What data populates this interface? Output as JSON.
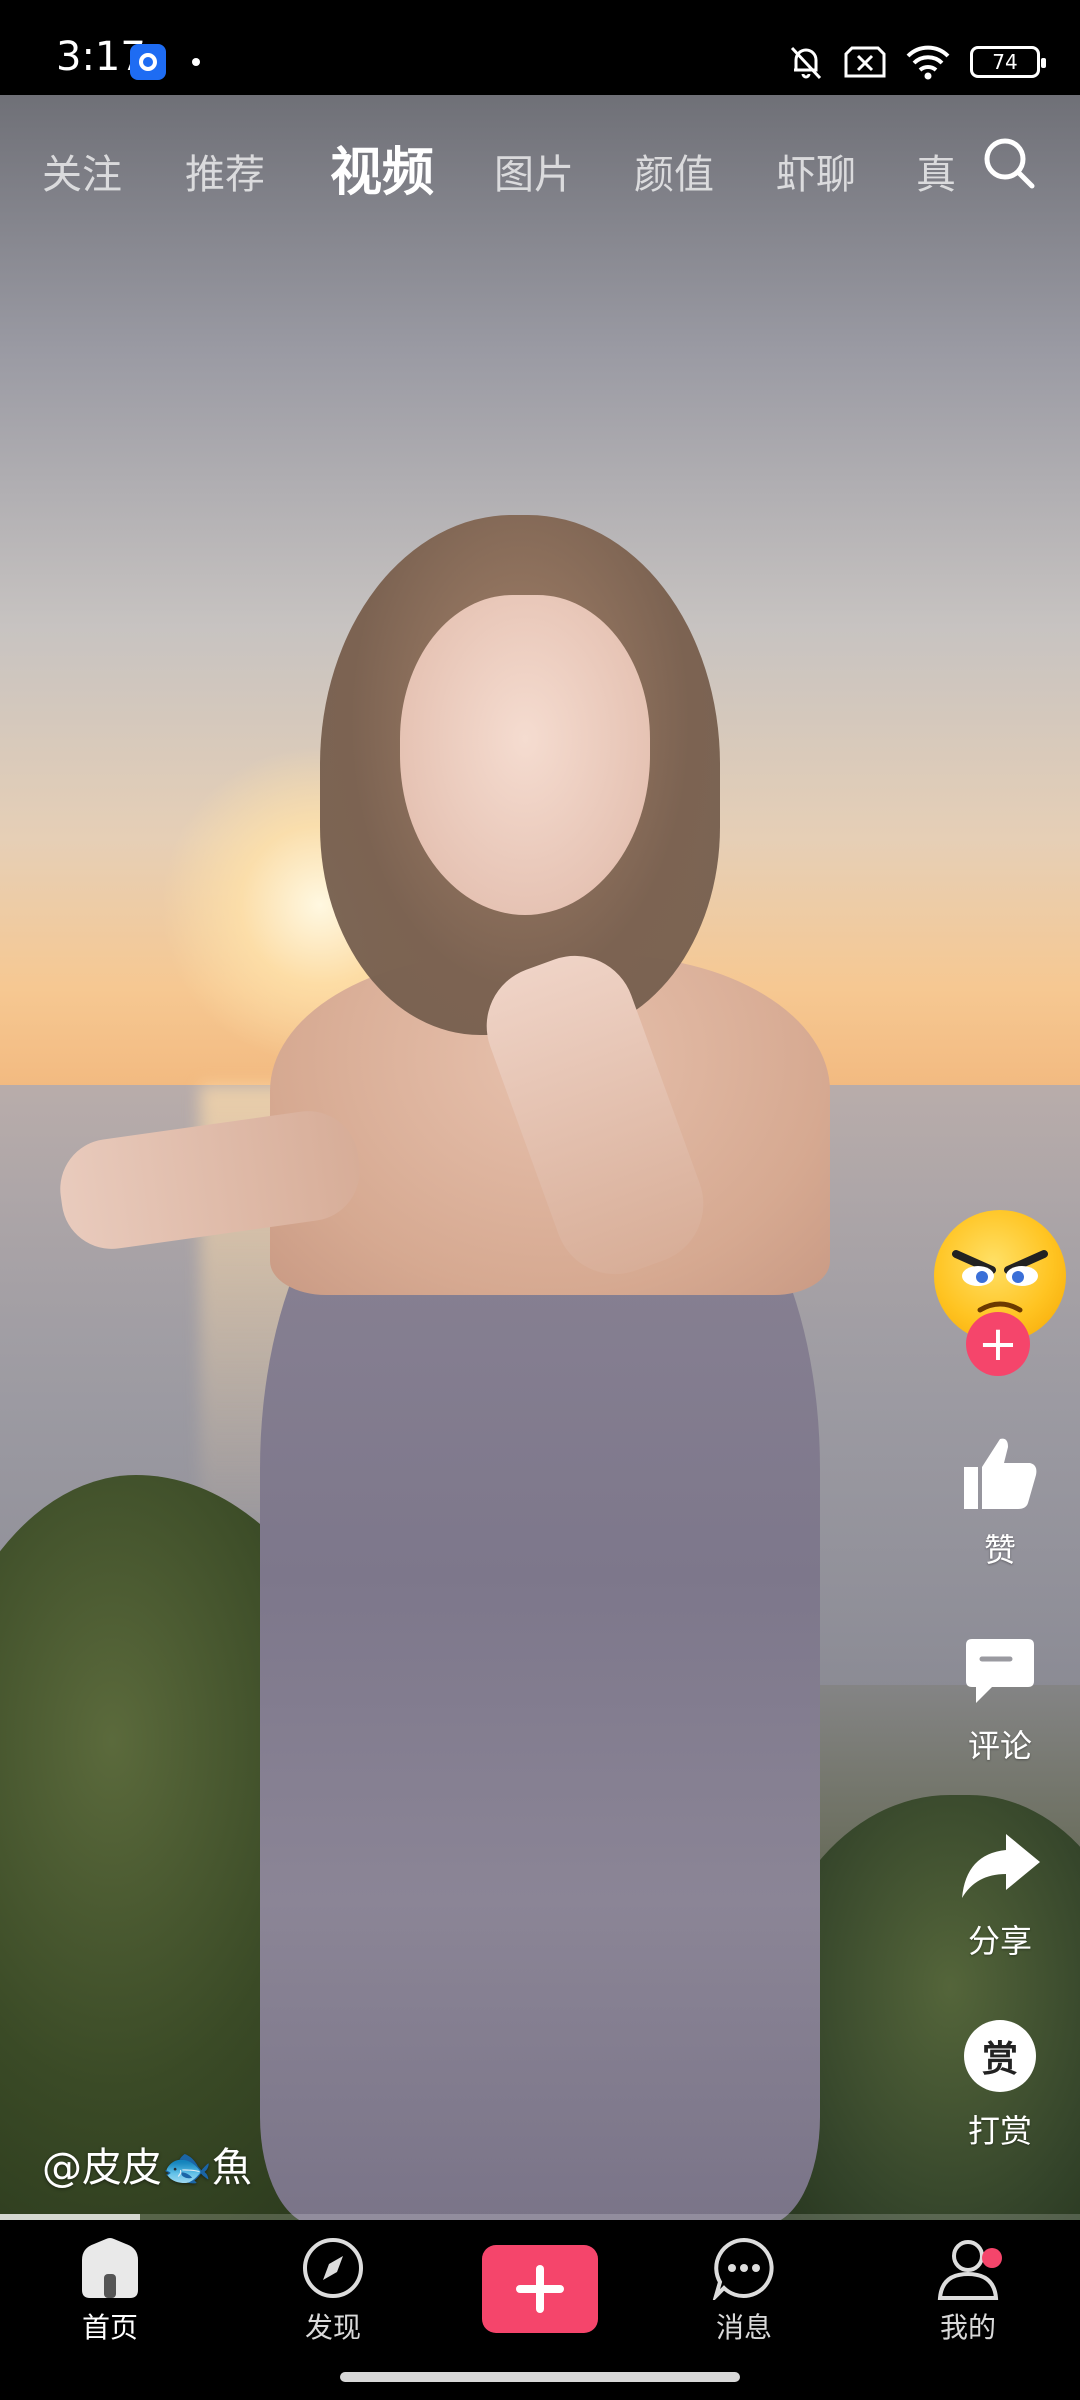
{
  "status_bar": {
    "time": "3:17",
    "battery_level": "74",
    "icons": [
      "app-icon",
      "mute-icon",
      "no-sim-icon",
      "wifi-icon",
      "battery-icon"
    ]
  },
  "top_tabs": [
    {
      "label": "关注",
      "active": false
    },
    {
      "label": "推荐",
      "active": false
    },
    {
      "label": "视频",
      "active": true
    },
    {
      "label": "图片",
      "active": false
    },
    {
      "label": "颜值",
      "active": false
    },
    {
      "label": "虾聊",
      "active": false
    },
    {
      "label": "真",
      "active": false
    }
  ],
  "actions": {
    "follow_symbol": "+",
    "like_label": "赞",
    "comment_label": "评论",
    "share_label": "分享",
    "reward_glyph": "赏",
    "reward_label": "打赏"
  },
  "video": {
    "author_prefix": "@皮皮",
    "author_emoji": "🐟",
    "author_suffix": "魚",
    "progress": 0.13
  },
  "bottom_nav": [
    {
      "label": "首页",
      "icon": "home-icon",
      "active": true
    },
    {
      "label": "发现",
      "icon": "compass-icon",
      "active": false
    },
    {
      "label": "",
      "icon": "plus-icon",
      "active": false
    },
    {
      "label": "消息",
      "icon": "message-icon",
      "active": false
    },
    {
      "label": "我的",
      "icon": "profile-icon",
      "active": false,
      "badge": true
    }
  ],
  "colors": {
    "accent": "#f5456b",
    "nav_background": "#000000"
  }
}
